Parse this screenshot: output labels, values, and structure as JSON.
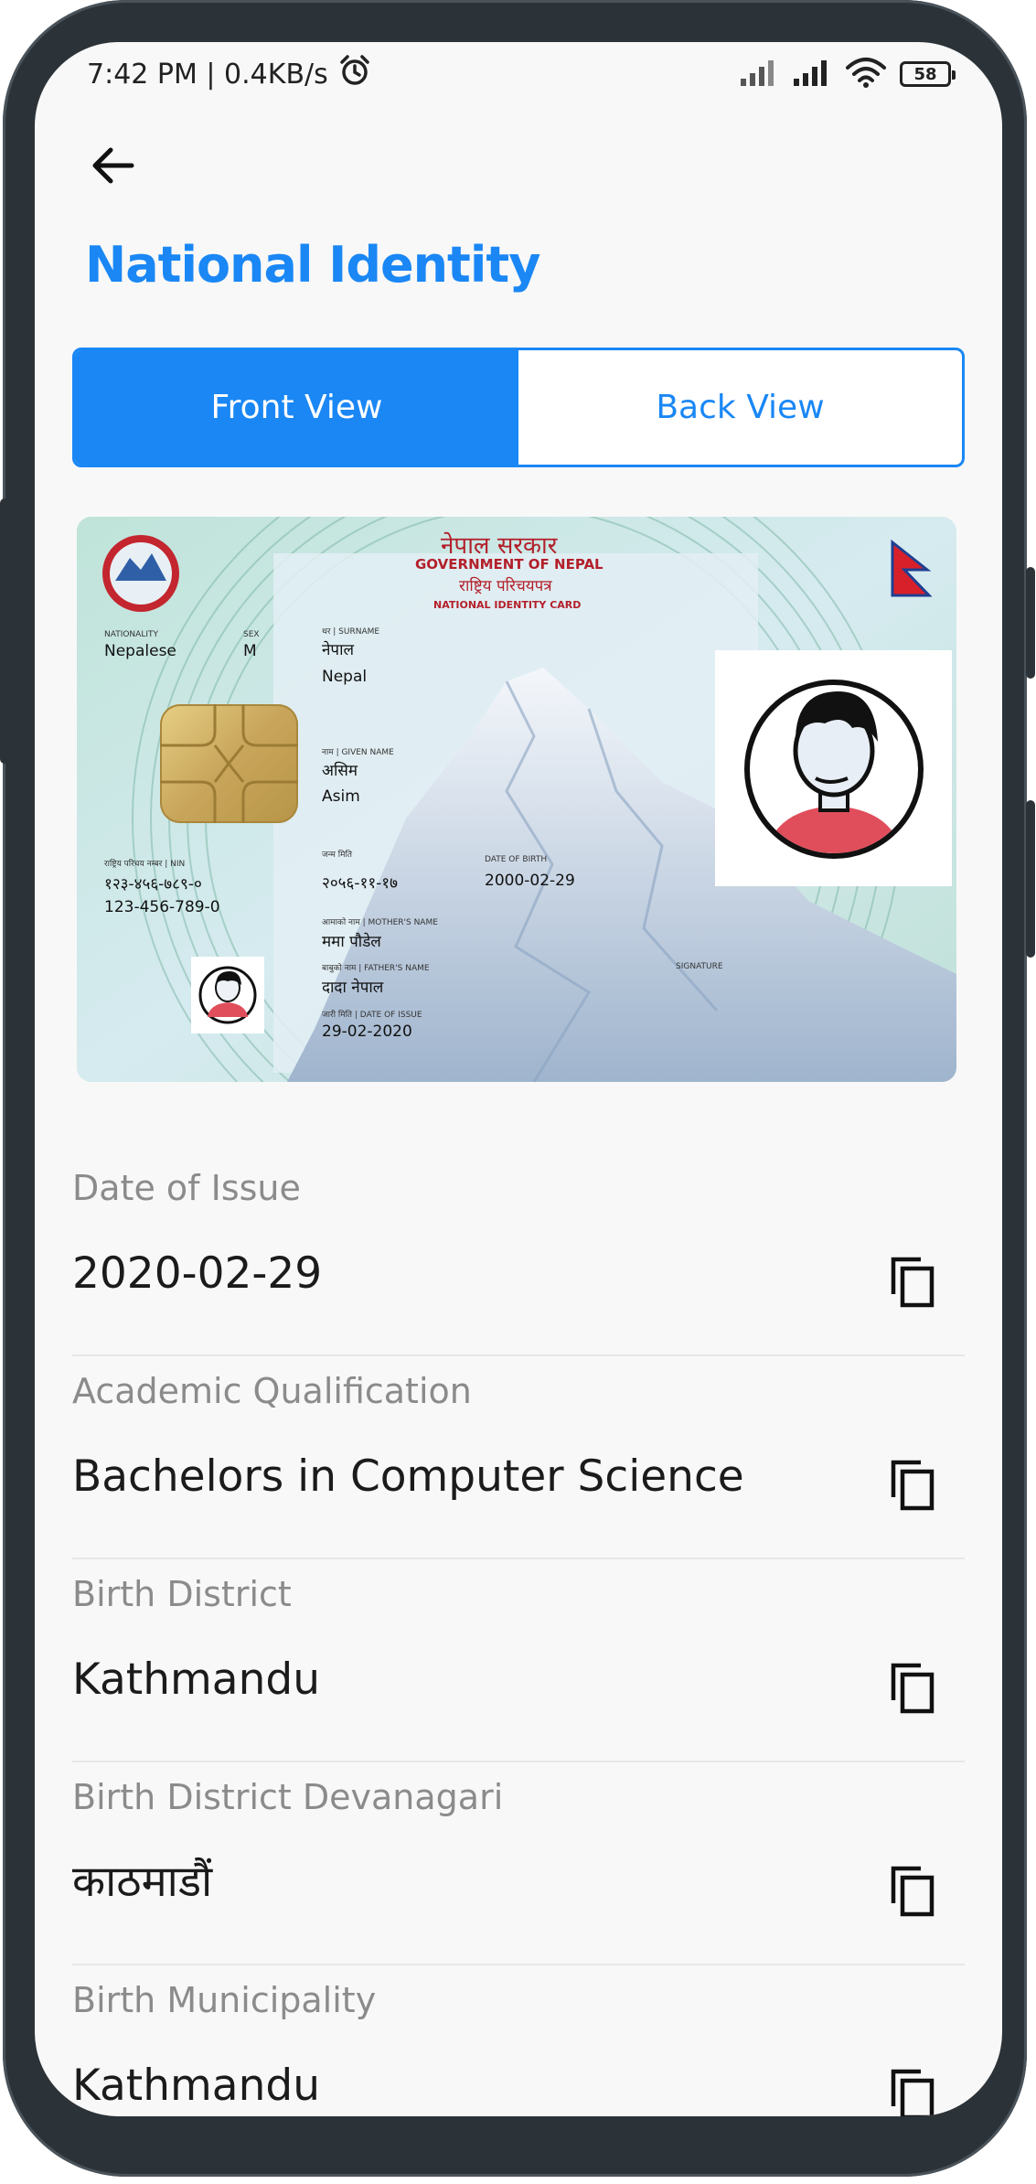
{
  "status_bar": {
    "time_speed": "7:42 PM | 0.4KB/s",
    "battery": "58"
  },
  "icons": {
    "back": "arrow-left-icon",
    "alarm": "alarm-clock-icon",
    "signal": "signal-bars-icon",
    "wifi": "wifi-icon",
    "copy": "copy-icon"
  },
  "header": {
    "title": "National Identity"
  },
  "tabs": {
    "front": "Front View",
    "back": "Back View",
    "selected": "Front View"
  },
  "card": {
    "header_devanagari": "नेपाल सरकार",
    "government": "GOVERNMENT OF NEPAL",
    "card_devanagari": "राष्ट्रिय परिचयपत्र",
    "card_title": "NATIONAL IDENTITY CARD",
    "nationality_label": "NATIONALITY",
    "nationality": "Nepalese",
    "sex_label": "SEX",
    "sex": "M",
    "surname_label": "थर | SURNAME",
    "surname_devanagari": "नेपाल",
    "surname": "Nepal",
    "given_name_label": "नाम | GIVEN NAME",
    "given_name_devanagari": "असिम",
    "given_name": "Asim",
    "nin_label": "राष्ट्रिय परिचय नम्बर | NIN",
    "nin_devanagari": "१२३-४५६-७८९-०",
    "nin": "123-456-789-0",
    "dob_label_np": "जन्म मिति",
    "dob_devanagari": "२०५६-११-१७",
    "dob_label": "DATE OF BIRTH",
    "dob": "2000-02-29",
    "mother_label": "आमाको नाम | MOTHER'S NAME",
    "mother": "ममा पौडेल",
    "father_label": "बाबुको नाम | FATHER'S NAME",
    "father": "दादा नेपाल",
    "issue_label": "जारी मिति | DATE OF ISSUE",
    "issue_date": "29-02-2020",
    "signature_label": "SIGNATURE"
  },
  "details": [
    {
      "label": "Date of Issue",
      "value": "2020-02-29"
    },
    {
      "label": "Academic Qualification",
      "value": "Bachelors in Computer Science"
    },
    {
      "label": "Birth District",
      "value": "Kathmandu"
    },
    {
      "label": "Birth District Devanagari",
      "value": "काठमाडौं"
    },
    {
      "label": "Birth Municipality",
      "value": "Kathmandu"
    }
  ],
  "colors": {
    "accent": "#1a87f5",
    "frame": "#2c3338",
    "screen_bg": "#f8f8f8"
  }
}
